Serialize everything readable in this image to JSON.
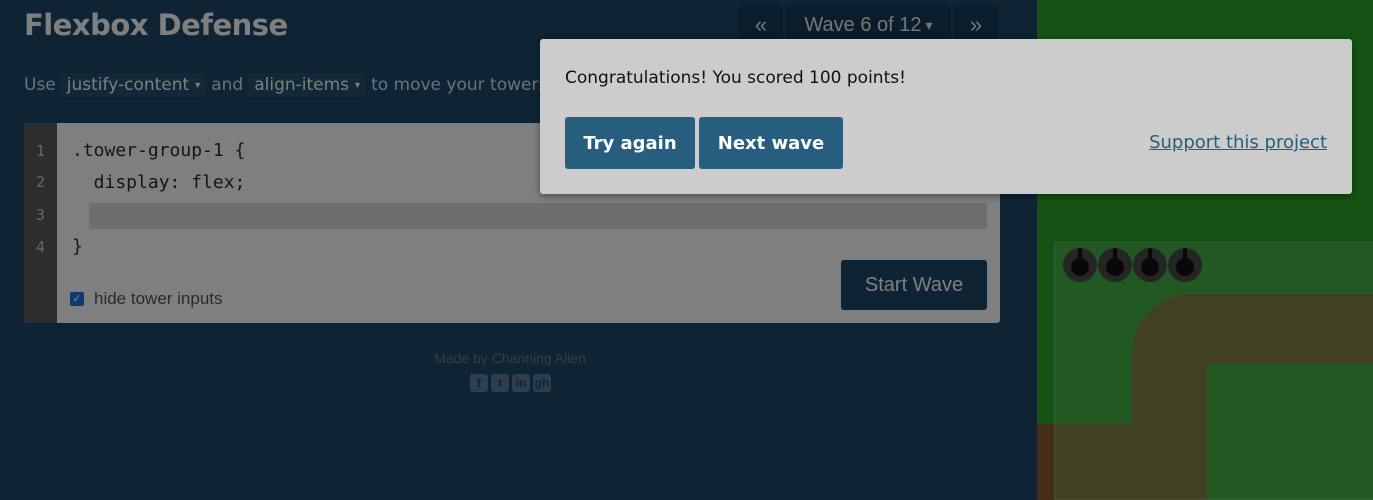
{
  "app": {
    "title": "Flexbox Defense"
  },
  "wave_nav": {
    "prev": "«",
    "label": "Wave 6 of 12",
    "caret": "▾",
    "next": "»"
  },
  "instructions": {
    "use": "Use",
    "property_1": "justify-content",
    "and": "and",
    "property_2": "align-items",
    "suffix": "to move your towers",
    "dropdown_glyph": "▾"
  },
  "editor": {
    "line_numbers": [
      "1",
      "2",
      "3",
      "4"
    ],
    "line_1": ".tower-group-1 {",
    "line_2": "  display: flex;",
    "line_3_value": "",
    "line_4": "}",
    "hide_inputs_label": "hide tower inputs",
    "hide_inputs_checked": true,
    "start_button": "Start Wave"
  },
  "footer": {
    "credit": "Made by Channing Allen",
    "social_icons": [
      "facebook-icon",
      "twitter-icon",
      "linkedin-icon",
      "github-icon"
    ],
    "social_glyphs": [
      "f",
      "t",
      "in",
      "gh"
    ]
  },
  "board": {
    "tower_count": 4,
    "colors": {
      "grass": "#2aa72a",
      "path": "#8a5a2c",
      "tower": "#4a4a4a"
    }
  },
  "modal": {
    "message": "Congratulations! You scored 100 points!",
    "try_again": "Try again",
    "next_wave": "Next wave",
    "support_link": "Support this project"
  },
  "colors": {
    "panel": "#1d4766",
    "button": "#275d7f",
    "modal_bg": "#cccccc"
  }
}
